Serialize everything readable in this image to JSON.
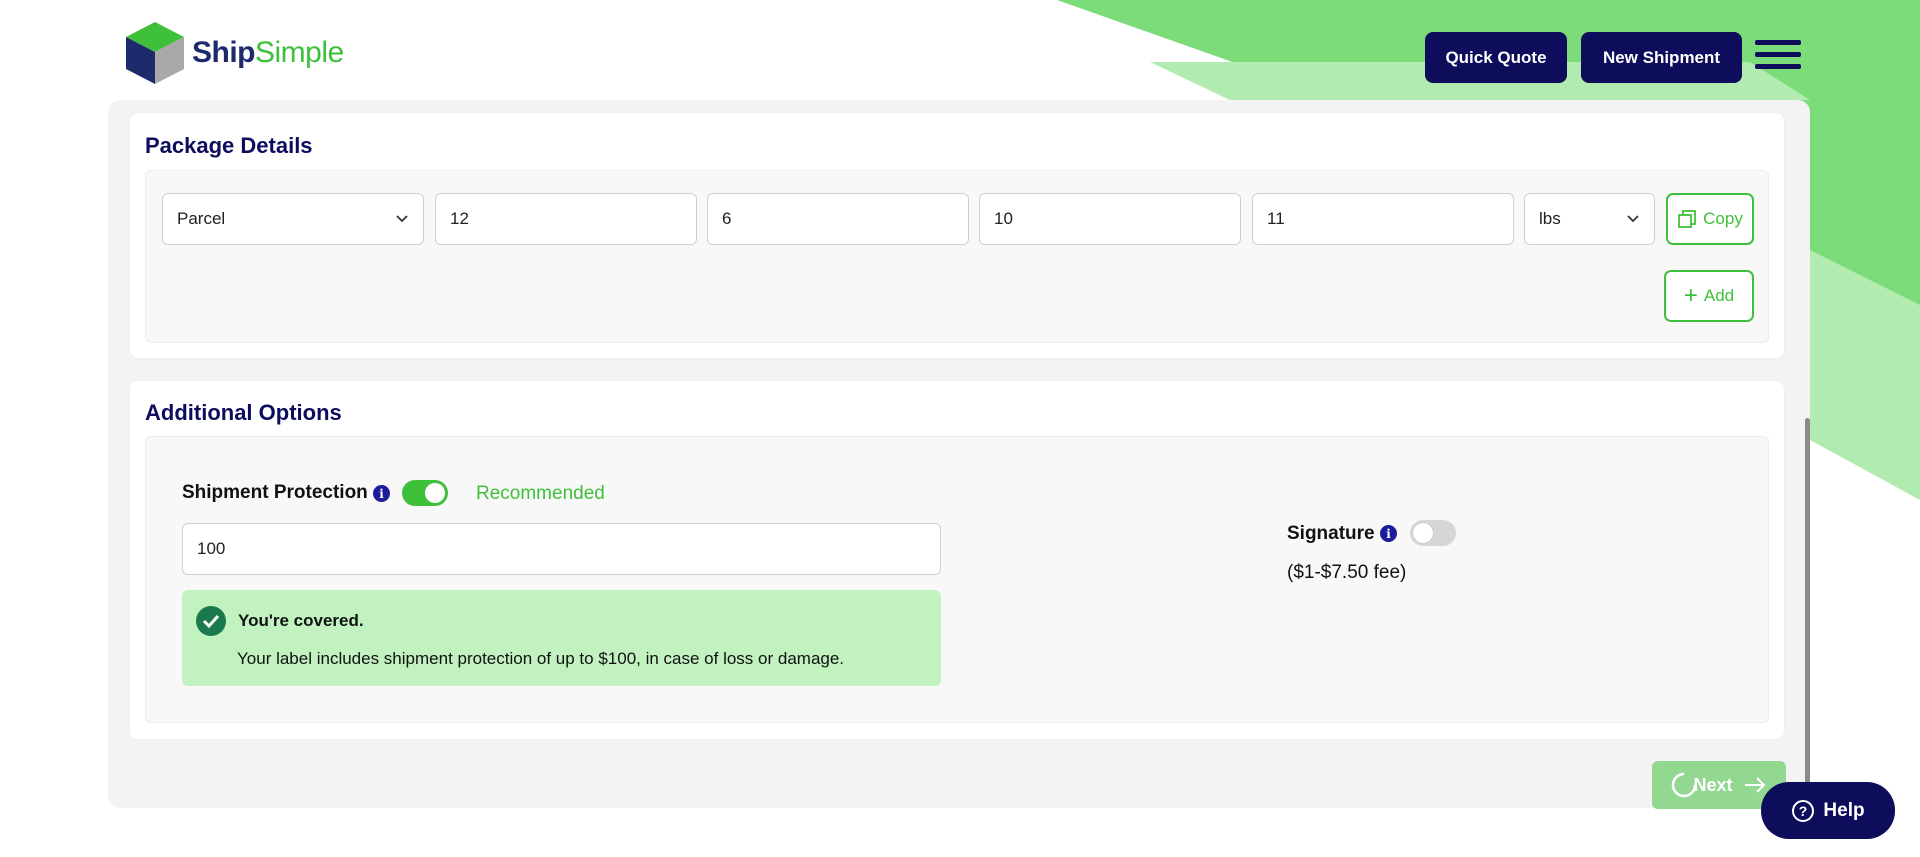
{
  "brand": {
    "name_part1": "Ship",
    "name_part2": "Simple",
    "accent": "#3fc03a",
    "primary": "#0d0d5c"
  },
  "header": {
    "quick_quote": "Quick Quote",
    "new_shipment": "New Shipment",
    "menu_icon": "hamburger-menu-icon"
  },
  "package_details": {
    "title": "Package Details",
    "package_type": "Parcel",
    "length": "12",
    "width": "6",
    "height": "10",
    "weight": "11",
    "weight_unit": "lbs",
    "copy_label": "Copy",
    "add_label": "Add"
  },
  "additional_options": {
    "title": "Additional Options",
    "protection_label": "Shipment Protection",
    "protection_enabled": true,
    "recommended": "Recommended",
    "protection_value": "100",
    "covered_title": "You're covered.",
    "covered_text": "Your label includes shipment protection of up to $100, in case of loss or damage.",
    "signature_label": "Signature",
    "signature_enabled": false,
    "signature_fee": "($1-$7.50 fee)"
  },
  "footer": {
    "next": "Next",
    "help": "Help"
  }
}
